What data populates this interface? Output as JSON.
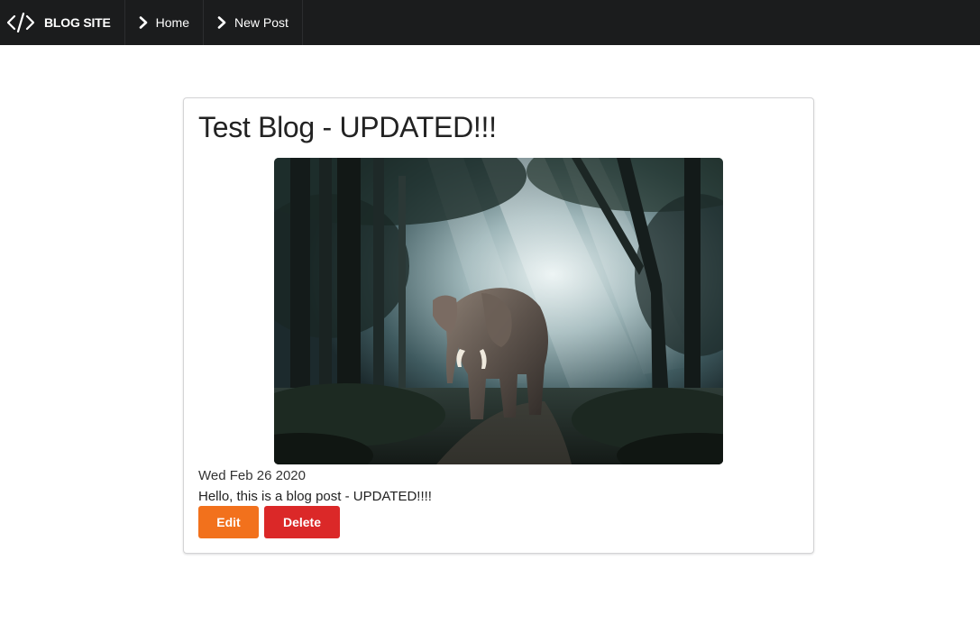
{
  "nav": {
    "brand": "BLOG SITE",
    "home": "Home",
    "new_post": "New Post"
  },
  "post": {
    "title": "Test Blog - UPDATED!!!",
    "date": "Wed Feb 26 2020",
    "body": "Hello, this is a blog post - UPDATED!!!!",
    "image": "elephant-in-forest-photo"
  },
  "actions": {
    "edit": "Edit",
    "delete": "Delete"
  },
  "colors": {
    "navbar": "#1b1c1d",
    "edit": "#f2711c",
    "delete": "#db2828"
  },
  "icons": {
    "brand": "code-icon",
    "nav": "chevron-right-icon"
  }
}
